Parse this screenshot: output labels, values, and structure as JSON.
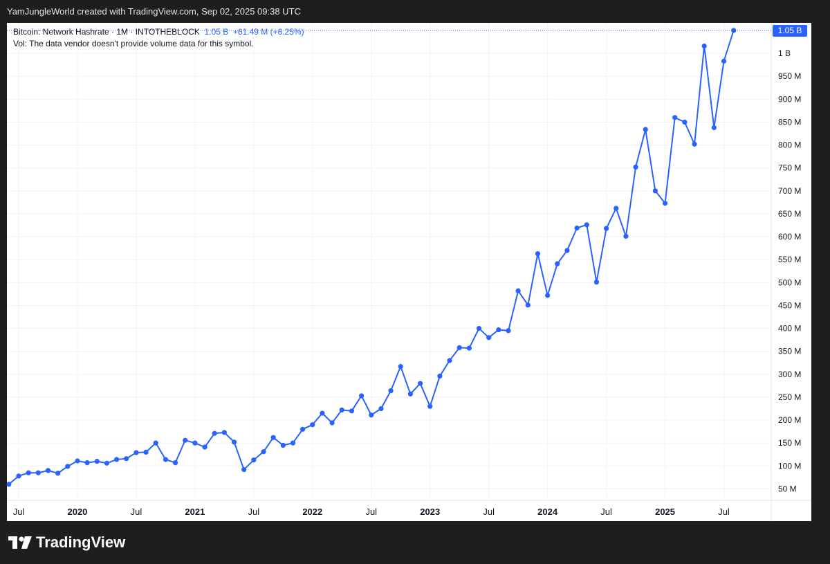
{
  "header": {
    "created_line": "YamJungleWorld created with TradingView.com, Sep 02, 2025 09:38 UTC"
  },
  "legend": {
    "symbol": "Bitcoin: Network Hashrate · 1M · INTOTHEBLOCK",
    "last": "1.05 B",
    "change": "+61.49 M (+6.25%)",
    "vol_note": "Vol: The data vendor doesn't provide volume data for this symbol."
  },
  "footer": {
    "brand": "TradingView"
  },
  "colors": {
    "line": "#2962ff",
    "price_tag": "#2962ff",
    "grid": "#f0f3fa"
  },
  "chart_data": {
    "type": "line",
    "title": "Bitcoin: Network Hashrate · 1M · INTOTHEBLOCK",
    "unit": "hashes/s",
    "x_ticks": [
      "Jul",
      "2020",
      "Jul",
      "2021",
      "Jul",
      "2022",
      "Jul",
      "2023",
      "Jul",
      "2024",
      "Jul",
      "2025",
      "Jul"
    ],
    "y_ticks": [
      "50 M",
      "100 M",
      "150 M",
      "200 M",
      "250 M",
      "300 M",
      "350 M",
      "400 M",
      "450 M",
      "500 M",
      "550 M",
      "600 M",
      "650 M",
      "700 M",
      "750 M",
      "800 M",
      "850 M",
      "900 M",
      "950 M",
      "1 B"
    ],
    "ylim_millions": [
      25,
      1100
    ],
    "last_value_label": "1.05 B",
    "series": [
      {
        "x": [
          "2019-06",
          "2019-07",
          "2019-08",
          "2019-09",
          "2019-10",
          "2019-11",
          "2019-12",
          "2020-01",
          "2020-02",
          "2020-03",
          "2020-04",
          "2020-05",
          "2020-06",
          "2020-07",
          "2020-08",
          "2020-09",
          "2020-10",
          "2020-11",
          "2020-12",
          "2021-01",
          "2021-02",
          "2021-03",
          "2021-04",
          "2021-05",
          "2021-06",
          "2021-07",
          "2021-08",
          "2021-09",
          "2021-10",
          "2021-11",
          "2021-12",
          "2022-01",
          "2022-02",
          "2022-03",
          "2022-04",
          "2022-05",
          "2022-06",
          "2022-07",
          "2022-08",
          "2022-09",
          "2022-10",
          "2022-11",
          "2022-12",
          "2023-01",
          "2023-02",
          "2023-03",
          "2023-04",
          "2023-05",
          "2023-06",
          "2023-07",
          "2023-08",
          "2023-09",
          "2023-10",
          "2023-11",
          "2023-12",
          "2024-01",
          "2024-02",
          "2024-03",
          "2024-04",
          "2024-05",
          "2024-06",
          "2024-07",
          "2024-08",
          "2024-09",
          "2024-10",
          "2024-11",
          "2024-12",
          "2025-01",
          "2025-02",
          "2025-03",
          "2025-04",
          "2025-05",
          "2025-06",
          "2025-07",
          "2025-08"
        ],
        "values_millions": [
          60,
          78,
          85,
          85,
          90,
          84,
          99,
          111,
          107,
          110,
          106,
          114,
          116,
          129,
          130,
          150,
          114,
          107,
          156,
          150,
          141,
          171,
          173,
          152,
          92,
          113,
          131,
          162,
          145,
          150,
          180,
          190,
          215,
          194,
          222,
          220,
          253,
          211,
          225,
          264,
          317,
          257,
          280,
          230,
          296,
          330,
          358,
          357,
          400,
          380,
          397,
          395,
          482,
          451,
          563,
          472,
          541,
          570,
          619,
          626,
          501,
          618,
          662,
          601,
          752,
          834,
          700,
          673,
          860,
          850,
          802,
          1016,
          838,
          983,
          1050
        ]
      }
    ]
  }
}
